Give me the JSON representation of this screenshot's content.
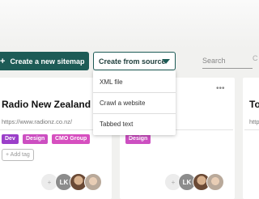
{
  "toolbar": {
    "create_sitemap_label": "Create a new sitemap",
    "create_from_source_label": "Create from source",
    "search_placeholder": "Search",
    "search_overflow": "C"
  },
  "dropdown": {
    "items": [
      "XML file",
      "Crawl a website",
      "Tabbed text"
    ]
  },
  "cards": [
    {
      "title": "Radio New Zealand",
      "url": "https://www.radionz.co.nz/",
      "tags": [
        {
          "label": "Dev",
          "color": "#9b3fc9"
        },
        {
          "label": "Design",
          "color": "#cc4fc1"
        },
        {
          "label": "CMO Group",
          "color": "#d64fbf"
        }
      ],
      "add_tag_label": "+ Add tag",
      "avatars": [
        "+",
        "LK"
      ]
    },
    {
      "tags": [
        {
          "label": "Design",
          "color": "#cc4fc1"
        }
      ],
      "avatars": [
        "+",
        "LK"
      ]
    },
    {
      "title": "To",
      "url": "http"
    }
  ],
  "colors": {
    "primary": "#1d5b56",
    "background": "#f1f1ef"
  },
  "icons": {
    "plus": "+",
    "more": "•••"
  }
}
